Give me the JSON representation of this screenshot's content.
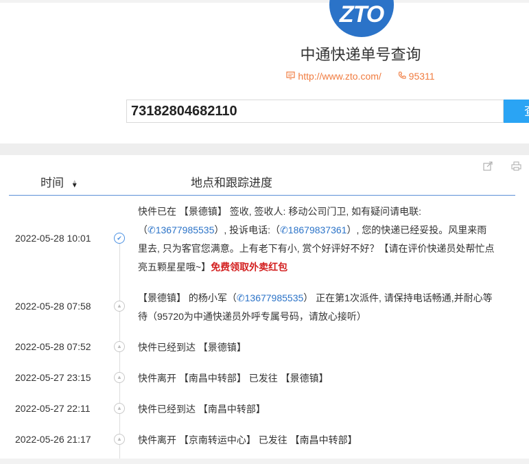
{
  "header": {
    "logo_text": "ZTO",
    "title": "中通快递单号查询",
    "website_icon": "web-icon",
    "website": "http://www.zto.com/",
    "phone_icon": "phone-icon",
    "phone": "95311"
  },
  "search": {
    "value": "73182804682110",
    "button_label": "查"
  },
  "table": {
    "col_time": "时间",
    "col_progress": "地点和跟踪进度",
    "share_icon": "share-icon",
    "print_icon": "print-icon"
  },
  "records": [
    {
      "time": "2022-05-28 10:01",
      "status": "delivered",
      "d1": "快件已在 【景德镇】 签收, 签收人: 移动公司门卫, 如有疑问请电联:",
      "d2a": "（",
      "phone1": "13677985535",
      "d2b": "）, 投诉电话:（",
      "phone2": "18679837361",
      "d2c": "）, 您的快递已经妥投。风里来雨",
      "d3": "里去, 只为客官您满意。上有老下有小, 赏个好评好不好？【请在评价快递员处帮忙点",
      "d4": "亮五颗星星哦~】",
      "promo": "免费领取外卖红包"
    },
    {
      "time": "2022-05-28 07:58",
      "status": "in-transit",
      "d1a": "【景德镇】 的杨小军（",
      "phone1": "13677985535",
      "d1b": "） 正在第1次派件, 请保持电话畅通,并耐心等",
      "d2": "待（95720为中通快递员外呼专属号码，请放心接听）"
    },
    {
      "time": "2022-05-28 07:52",
      "status": "in-transit",
      "desc": "快件已经到达 【景德镇】"
    },
    {
      "time": "2022-05-27 23:15",
      "status": "in-transit",
      "desc": "快件离开 【南昌中转部】 已发往 【景德镇】"
    },
    {
      "time": "2022-05-27 22:11",
      "status": "in-transit",
      "desc": "快件已经到达 【南昌中转部】"
    },
    {
      "time": "2022-05-26 21:17",
      "status": "in-transit",
      "desc": "快件离开 【京南转运中心】 已发往 【南昌中转部】"
    }
  ]
}
